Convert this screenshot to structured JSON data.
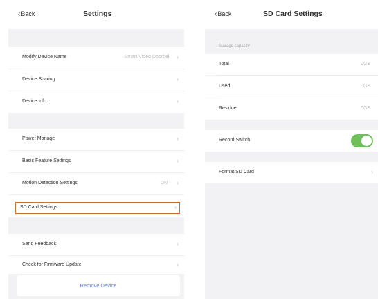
{
  "settings": {
    "back_label": "Back",
    "title": "Settings",
    "items": [
      {
        "label": "Modify Device Name",
        "value": "Smart Video Doorbell"
      },
      {
        "label": "Device Sharing"
      },
      {
        "label": "Device Info"
      },
      {
        "label": "Power Manage"
      },
      {
        "label": "Basic Feature Settings"
      },
      {
        "label": "Motion Detection Settings",
        "value": "ON"
      },
      {
        "label": "SD Card Settings"
      },
      {
        "label": "Send Feedback"
      },
      {
        "label": "Check for Firmware Update"
      }
    ],
    "remove_label": "Remove Device"
  },
  "sd_card": {
    "back_label": "Back",
    "title": "SD Card Settings",
    "section_label": "Storage capacity",
    "storage": [
      {
        "label": "Total",
        "value": "0GB"
      },
      {
        "label": "Used",
        "value": "0GB"
      },
      {
        "label": "Residue",
        "value": "0GB"
      }
    ],
    "record_switch": {
      "label": "Record Switch",
      "state": "on",
      "color": "#6fbf5a"
    },
    "format_label": "Format SD Card"
  },
  "colors": {
    "highlight_border": "#d4702e",
    "remove_text": "#5b7fd6"
  }
}
